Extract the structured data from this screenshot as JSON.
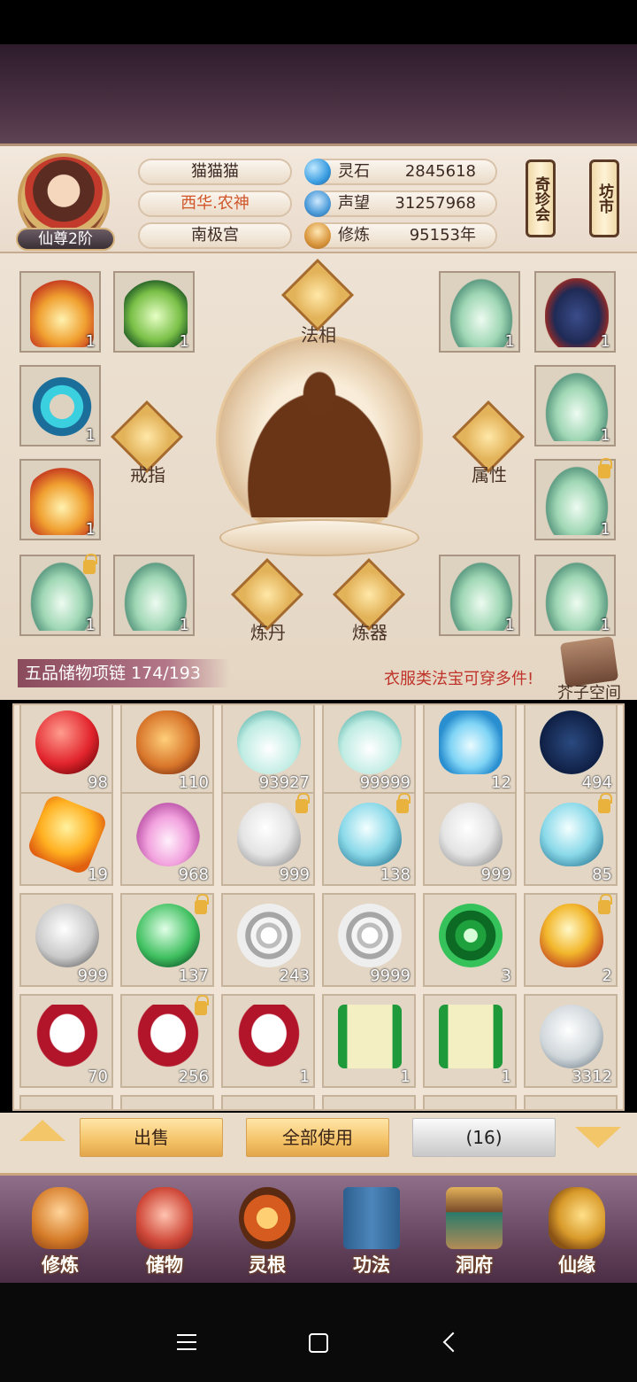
{
  "player": {
    "name": "猫猫猫",
    "title": "西华.农神",
    "location": "南极宫",
    "rank": "仙尊2阶"
  },
  "stats": {
    "spirit_stone_label": "灵石",
    "spirit_stone_value": "2845618",
    "prestige_label": "声望",
    "prestige_value": "31257968",
    "cultivation_label": "修炼",
    "cultivation_value": "95153年"
  },
  "side_buttons": {
    "treasure": "奇珍会",
    "market": "坊市"
  },
  "equipment": {
    "center_labels": {
      "faxiang": "法相",
      "ring": "戒指",
      "attributes": "属性",
      "alchemy": "炼丹",
      "forging": "炼器"
    },
    "slots": [
      {
        "count": "1"
      },
      {
        "count": "1"
      },
      {
        "count": "1"
      },
      {
        "count": "1"
      },
      {
        "count": "1"
      },
      {
        "count": "1"
      },
      {
        "count": "1"
      },
      {
        "count": "1"
      },
      {
        "count": "1"
      },
      {
        "count": "1"
      },
      {
        "count": "1"
      },
      {
        "count": "1"
      }
    ]
  },
  "bag": {
    "title": "五品储物项链 174/193",
    "hint": "衣服类法宝可穿多件!",
    "space_button": "芥子空间",
    "items": [
      {
        "icon": "red-orb-icon",
        "count": "98"
      },
      {
        "icon": "gourd-icon",
        "count": "110"
      },
      {
        "icon": "potion-icon",
        "count": "93927"
      },
      {
        "icon": "potion-icon",
        "count": "99999"
      },
      {
        "icon": "bowl-icon",
        "count": "12"
      },
      {
        "icon": "star-disc-icon",
        "count": "494"
      },
      {
        "icon": "amber-gem-icon",
        "count": "19"
      },
      {
        "icon": "lotus-icon",
        "count": "968"
      },
      {
        "icon": "white-egg-icon",
        "count": "999"
      },
      {
        "icon": "teal-egg-icon",
        "count": "138"
      },
      {
        "icon": "white-egg-icon",
        "count": "999"
      },
      {
        "icon": "teal-egg-icon",
        "count": "85"
      },
      {
        "icon": "skull-icon",
        "count": "999"
      },
      {
        "icon": "green-skull-icon",
        "count": "137"
      },
      {
        "icon": "silver-swirl-icon",
        "count": "243"
      },
      {
        "icon": "silver-swirl-icon",
        "count": "9999"
      },
      {
        "icon": "green-swirl-icon",
        "count": "3"
      },
      {
        "icon": "gold-egg-icon",
        "count": "2"
      },
      {
        "icon": "rice-plate-icon",
        "count": "70"
      },
      {
        "icon": "rice-plate-icon",
        "count": "256"
      },
      {
        "icon": "rice-plate-icon",
        "count": "1"
      },
      {
        "icon": "scroll-icon",
        "count": "1"
      },
      {
        "icon": "scroll-icon",
        "count": "1"
      },
      {
        "icon": "silver-orb-icon",
        "count": "3312"
      }
    ]
  },
  "actions": {
    "sell": "出售",
    "use_all": "全部使用",
    "selected": "(16)"
  },
  "nav": [
    {
      "label": "修炼",
      "icon": "monk-icon"
    },
    {
      "label": "储物",
      "icon": "bag-icon"
    },
    {
      "label": "灵根",
      "icon": "spirit-root-icon"
    },
    {
      "label": "功法",
      "icon": "book-icon"
    },
    {
      "label": "洞府",
      "icon": "pavilion-icon"
    },
    {
      "label": "仙缘",
      "icon": "gourd-icon"
    }
  ]
}
